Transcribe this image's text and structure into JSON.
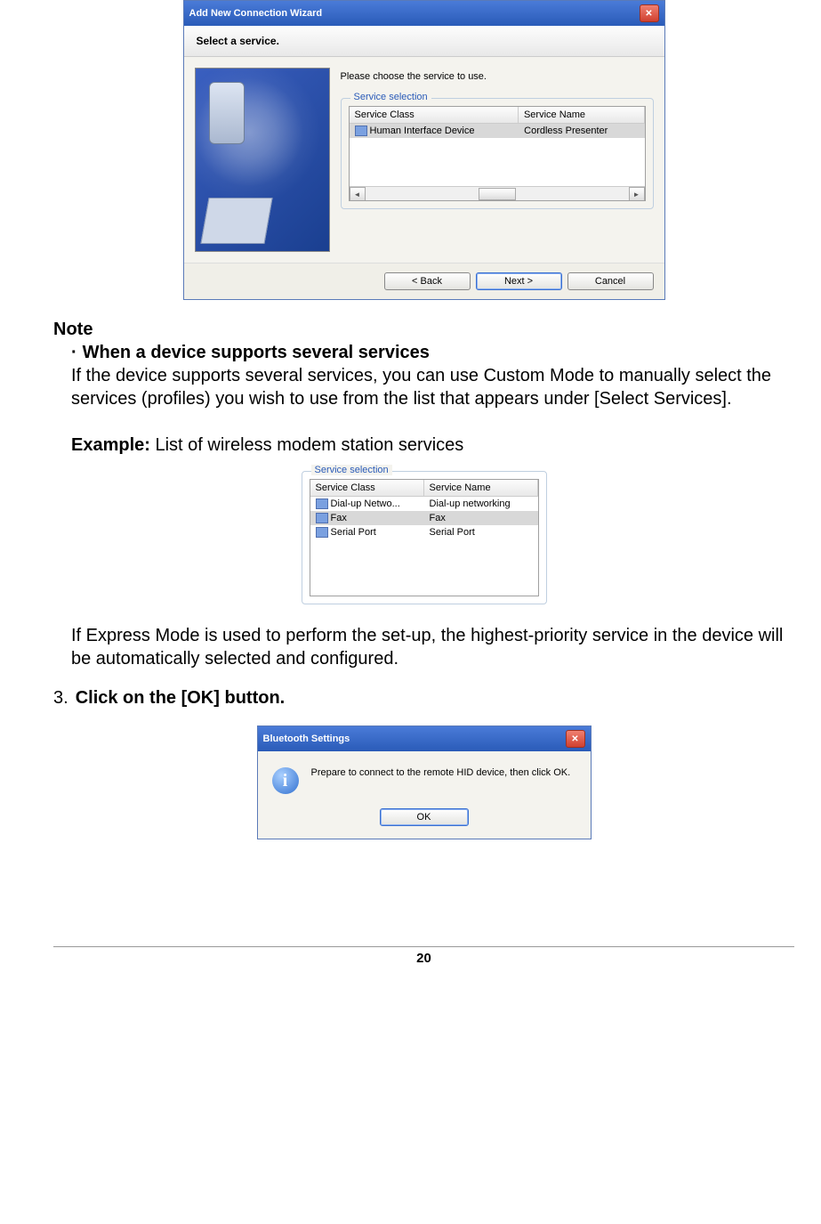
{
  "wizard": {
    "title": "Add New Connection Wizard",
    "banner": "Select a service.",
    "instruction": "Please choose the service to use.",
    "fieldset_label": "Service selection",
    "columns": {
      "class": "Service Class",
      "name": "Service Name"
    },
    "row": {
      "class": "Human Interface Device",
      "name": "Cordless Presenter"
    },
    "buttons": {
      "back": "< Back",
      "next": "Next >",
      "cancel": "Cancel"
    }
  },
  "doc": {
    "note_heading": "Note",
    "bullet_mark": "·",
    "bullet_title": "When a device supports several services",
    "para1": "If the device supports several services, you can use Custom Mode to manually select the services (profiles) you wish to use from the list that appears under [Select Services].",
    "example_label": "Example:",
    "example_text": " List of wireless modem station services",
    "para2": "If Express Mode is used to perform the set-up, the highest-priority service in the device will be automatically selected and configured.",
    "step_num": "3.",
    "step_text": "Click on the [OK] button.",
    "page_number": "20"
  },
  "example_list": {
    "fieldset_label": "Service selection",
    "columns": {
      "class": "Service Class",
      "name": "Service Name"
    },
    "rows": [
      {
        "class": "Dial-up Netwo...",
        "name": "Dial-up networking"
      },
      {
        "class": "Fax",
        "name": "Fax"
      },
      {
        "class": "Serial Port",
        "name": "Serial Port"
      }
    ]
  },
  "msgbox": {
    "title": "Bluetooth Settings",
    "text": "Prepare to connect to the remote HID device, then click OK.",
    "ok": "OK"
  }
}
